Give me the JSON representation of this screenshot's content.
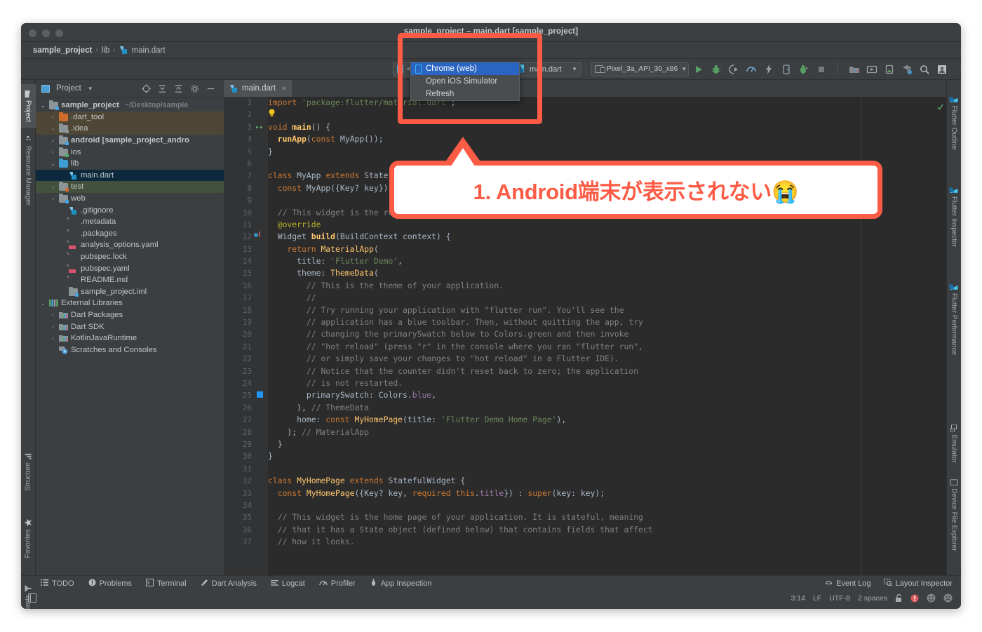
{
  "window": {
    "title": "sample_project – main.dart [sample_project]",
    "traffic_lights": [
      "close",
      "minimize",
      "zoom"
    ]
  },
  "breadcrumb": {
    "items": [
      "sample_project",
      "lib",
      "main.dart"
    ],
    "separator": "›"
  },
  "toolbar": {
    "project_view_label": "Project",
    "device_selector": {
      "value": "<no device selected>",
      "icon": "phone-icon",
      "options": [
        "Chrome (web)",
        "Open iOS Simulator",
        "Refresh"
      ],
      "selected_option": "Chrome (web)"
    },
    "run_config": {
      "value": "main.dart",
      "icon": "flutter-icon"
    },
    "emulator_target": {
      "value": "Pixel_3a_API_30_x86",
      "icon": "device-icon"
    },
    "action_icons": [
      "run-icon",
      "debug-icon",
      "run-coverage-icon",
      "profile-icon",
      "hot-reload-icon",
      "flutter-attach-icon",
      "restart-icon",
      "stop-icon",
      "avd-manager-icon",
      "sdk-manager-icon",
      "device-manager-icon",
      "project-structure-icon",
      "search-everywhere-icon",
      "account-icon"
    ]
  },
  "left_tool_strip": {
    "top": [
      {
        "label": "Project",
        "icon": "project-icon",
        "active": true
      },
      {
        "label": "Resource Manager",
        "icon": "resource-manager-icon",
        "active": false
      }
    ],
    "bottom": [
      {
        "label": "Structure",
        "icon": "structure-icon"
      },
      {
        "label": "Favorites",
        "icon": "star-icon"
      },
      {
        "label": "Build Variants",
        "icon": "build-variants-icon"
      }
    ]
  },
  "right_tool_strip": {
    "top": [
      {
        "label": "Flutter Outline",
        "icon": "flutter-icon"
      },
      {
        "label": "Flutter Inspector",
        "icon": "flutter-icon"
      },
      {
        "label": "Flutter Performance",
        "icon": "flutter-icon"
      }
    ],
    "bottom": [
      {
        "label": "Emulator",
        "icon": "emulator-icon"
      },
      {
        "label": "Device File Explorer",
        "icon": "device-file-explorer-icon"
      }
    ]
  },
  "project_panel": {
    "header": {
      "title": "Project",
      "icons": [
        "locate-icon",
        "expand-all-icon",
        "collapse-all-icon",
        "gear-icon",
        "hide-icon"
      ]
    },
    "tree": [
      {
        "depth": 0,
        "arrow": "⌄",
        "label": "sample_project",
        "sub": "~/Desktop/sample",
        "icon": "module-folder",
        "bold": true,
        "row_bg": "none"
      },
      {
        "depth": 1,
        "arrow": "›",
        "label": ".dart_tool",
        "sub": "",
        "icon": "orange-folder",
        "bold": false,
        "row_bg": "#4f4736"
      },
      {
        "depth": 1,
        "arrow": "›",
        "label": ".idea",
        "sub": "",
        "icon": "settings-folder",
        "bold": false,
        "row_bg": "#4f4736"
      },
      {
        "depth": 1,
        "arrow": "›",
        "label": "android [sample_project_andro",
        "sub": "",
        "icon": "module-folder",
        "bold": true,
        "row_bg": "none"
      },
      {
        "depth": 1,
        "arrow": "›",
        "label": "ios",
        "sub": "",
        "icon": "source-folder",
        "bold": false,
        "row_bg": "none"
      },
      {
        "depth": 1,
        "arrow": "⌄",
        "label": "lib",
        "sub": "",
        "icon": "blue-folder",
        "bold": false,
        "row_bg": "none"
      },
      {
        "depth": 2,
        "arrow": "",
        "label": "main.dart",
        "sub": "",
        "icon": "dart-file",
        "bold": false,
        "row_bg": "#0d293e"
      },
      {
        "depth": 1,
        "arrow": "›",
        "label": "test",
        "sub": "",
        "icon": "test-folder",
        "bold": false,
        "row_bg": "#44503e"
      },
      {
        "depth": 1,
        "arrow": "›",
        "label": "web",
        "sub": "",
        "icon": "web-folder",
        "bold": false,
        "row_bg": "none"
      },
      {
        "depth": 2,
        "arrow": "",
        "label": ".gitignore",
        "sub": "",
        "icon": "git-file",
        "bold": false,
        "row_bg": "none"
      },
      {
        "depth": 2,
        "arrow": "",
        "label": ".metadata",
        "sub": "",
        "icon": "text-file",
        "bold": false,
        "row_bg": "none"
      },
      {
        "depth": 2,
        "arrow": "",
        "label": ".packages",
        "sub": "",
        "icon": "text-file",
        "bold": false,
        "row_bg": "none"
      },
      {
        "depth": 2,
        "arrow": "",
        "label": "analysis_options.yaml",
        "sub": "",
        "icon": "yaml-file",
        "bold": false,
        "row_bg": "none"
      },
      {
        "depth": 2,
        "arrow": "",
        "label": "pubspec.lock",
        "sub": "",
        "icon": "text-file",
        "bold": false,
        "row_bg": "none"
      },
      {
        "depth": 2,
        "arrow": "",
        "label": "pubspec.yaml",
        "sub": "",
        "icon": "yaml-file",
        "bold": false,
        "row_bg": "none"
      },
      {
        "depth": 2,
        "arrow": "",
        "label": "README.md",
        "sub": "",
        "icon": "text-file",
        "bold": false,
        "row_bg": "none"
      },
      {
        "depth": 2,
        "arrow": "",
        "label": "sample_project.iml",
        "sub": "",
        "icon": "module-folder",
        "bold": false,
        "row_bg": "none"
      },
      {
        "depth": 0,
        "arrow": "⌄",
        "label": "External Libraries",
        "sub": "",
        "icon": "libraries-icon",
        "bold": false,
        "row_bg": "none"
      },
      {
        "depth": 1,
        "arrow": "›",
        "label": "Dart Packages",
        "sub": "",
        "icon": "library-icon",
        "bold": false,
        "row_bg": "none"
      },
      {
        "depth": 1,
        "arrow": "›",
        "label": "Dart SDK",
        "sub": "",
        "icon": "library-icon",
        "bold": false,
        "row_bg": "none"
      },
      {
        "depth": 1,
        "arrow": "›",
        "label": "KotlinJavaRuntime",
        "sub": "",
        "icon": "library-icon",
        "bold": false,
        "row_bg": "none"
      },
      {
        "depth": 1,
        "arrow": "",
        "label": "Scratches and Consoles",
        "sub": "",
        "icon": "scratches-icon",
        "bold": false,
        "row_bg": "none"
      }
    ]
  },
  "editor": {
    "tab": {
      "label": "main.dart",
      "icon": "dart-file",
      "close": "×"
    },
    "file_name": "main.dart",
    "lines": [
      {
        "n": 1,
        "text": "import 'package:flutter/material.dart';"
      },
      {
        "n": 2,
        "text": ""
      },
      {
        "n": 3,
        "text": "void main() {"
      },
      {
        "n": 4,
        "text": "  runApp(const MyApp());"
      },
      {
        "n": 5,
        "text": "}"
      },
      {
        "n": 6,
        "text": ""
      },
      {
        "n": 7,
        "text": "class MyApp extends StatelessWidget {"
      },
      {
        "n": 8,
        "text": "  const MyApp({Key? key}) : super(key: key);"
      },
      {
        "n": 9,
        "text": ""
      },
      {
        "n": 10,
        "text": "  // This widget is the root of your application."
      },
      {
        "n": 11,
        "text": "  @override"
      },
      {
        "n": 12,
        "text": "  Widget build(BuildContext context) {"
      },
      {
        "n": 13,
        "text": "    return MaterialApp("
      },
      {
        "n": 14,
        "text": "      title: 'Flutter Demo',"
      },
      {
        "n": 15,
        "text": "      theme: ThemeData("
      },
      {
        "n": 16,
        "text": "        // This is the theme of your application."
      },
      {
        "n": 17,
        "text": "        //"
      },
      {
        "n": 18,
        "text": "        // Try running your application with \"flutter run\". You'll see the"
      },
      {
        "n": 19,
        "text": "        // application has a blue toolbar. Then, without quitting the app, try"
      },
      {
        "n": 20,
        "text": "        // changing the primarySwatch below to Colors.green and then invoke"
      },
      {
        "n": 21,
        "text": "        // \"hot reload\" (press \"r\" in the console where you ran \"flutter run\","
      },
      {
        "n": 22,
        "text": "        // or simply save your changes to \"hot reload\" in a Flutter IDE)."
      },
      {
        "n": 23,
        "text": "        // Notice that the counter didn't reset back to zero; the application"
      },
      {
        "n": 24,
        "text": "        // is not restarted."
      },
      {
        "n": 25,
        "text": "        primarySwatch: Colors.blue,"
      },
      {
        "n": 26,
        "text": "      ), // ThemeData"
      },
      {
        "n": 27,
        "text": "      home: const MyHomePage(title: 'Flutter Demo Home Page'),"
      },
      {
        "n": 28,
        "text": "    ); // MaterialApp"
      },
      {
        "n": 29,
        "text": "  }"
      },
      {
        "n": 30,
        "text": "}"
      },
      {
        "n": 31,
        "text": ""
      },
      {
        "n": 32,
        "text": "class MyHomePage extends StatefulWidget {"
      },
      {
        "n": 33,
        "text": "  const MyHomePage({Key? key, required this.title}) : super(key: key);"
      },
      {
        "n": 34,
        "text": ""
      },
      {
        "n": 35,
        "text": "  // This widget is the home page of your application. It is stateful, meaning"
      },
      {
        "n": 36,
        "text": "  // that it has a State object (defined below) that contains fields that affect"
      },
      {
        "n": 37,
        "text": "  // how it looks."
      }
    ],
    "gutter_markers": {
      "2": "intention-bulb-icon",
      "3": "run-gutter-icon",
      "12": "override-method-icon",
      "25": "color-swatch-icon"
    }
  },
  "tool_windows": {
    "left": [
      {
        "label": "TODO",
        "icon": "todo-icon"
      },
      {
        "label": "Problems",
        "icon": "problems-icon"
      },
      {
        "label": "Terminal",
        "icon": "terminal-icon"
      },
      {
        "label": "Dart Analysis",
        "icon": "dart-analysis-icon"
      },
      {
        "label": "Logcat",
        "icon": "logcat-icon"
      },
      {
        "label": "Profiler",
        "icon": "profiler-icon"
      },
      {
        "label": "App Inspection",
        "icon": "app-inspection-icon"
      }
    ],
    "right": [
      {
        "label": "Event Log",
        "icon": "event-log-icon"
      },
      {
        "label": "Layout Inspector",
        "icon": "layout-inspector-icon"
      }
    ]
  },
  "status_bar": {
    "caret_position": "3:14",
    "line_separator": "LF",
    "encoding": "UTF-8",
    "indent": "2 spaces",
    "lock_icon": "unlocked-icon",
    "error_icon": "error-badge-icon",
    "inspection_icon": "inspection-happy-icon",
    "face_icon": "inspection-sad-icon"
  },
  "annotations": {
    "callout_text": "1. Android端末が表示されない😭",
    "highlight_color": "#fc5b45",
    "callout_bg": "#ffffff"
  }
}
